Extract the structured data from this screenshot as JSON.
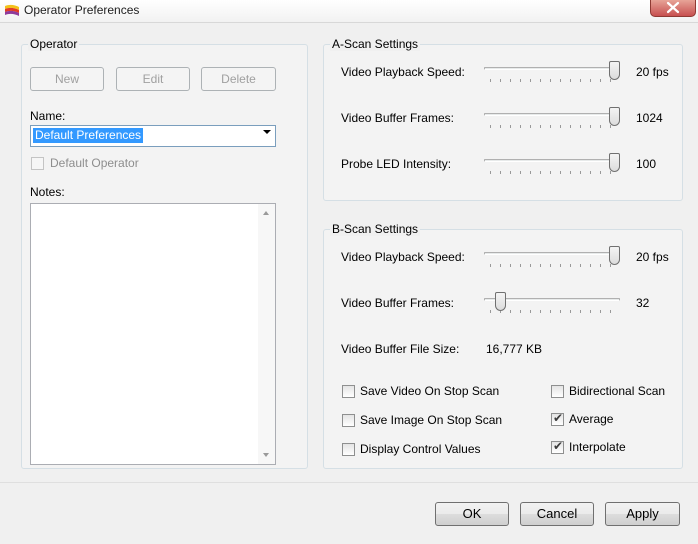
{
  "window": {
    "title": "Operator Preferences",
    "close_label": ""
  },
  "operator": {
    "group_title": "Operator",
    "new_label": "New",
    "edit_label": "Edit",
    "delete_label": "Delete",
    "name_label": "Name:",
    "name_value": "Default Preferences",
    "default_operator_label": "Default Operator",
    "default_operator_checked": false,
    "notes_label": "Notes:",
    "notes_value": ""
  },
  "ascan": {
    "group_title": "A-Scan Settings",
    "playback_speed_label": "Video Playback Speed:",
    "playback_speed_value": "20 fps",
    "playback_speed_fraction": 1.0,
    "buffer_frames_label": "Video Buffer Frames:",
    "buffer_frames_value": "1024",
    "buffer_frames_fraction": 1.0,
    "probe_led_label": "Probe LED Intensity:",
    "probe_led_value": "100",
    "probe_led_fraction": 1.0
  },
  "bscan": {
    "group_title": "B-Scan Settings",
    "playback_speed_label": "Video Playback Speed:",
    "playback_speed_value": "20 fps",
    "playback_speed_fraction": 1.0,
    "buffer_frames_label": "Video Buffer Frames:",
    "buffer_frames_value": "32",
    "buffer_frames_fraction": 0.08,
    "buffer_file_size_label": "Video Buffer File Size:",
    "buffer_file_size_value": "16,777 KB",
    "save_video_label": "Save Video On Stop Scan",
    "save_video_checked": false,
    "save_image_label": "Save Image On Stop Scan",
    "save_image_checked": false,
    "display_control_label": "Display Control Values",
    "display_control_checked": false,
    "bidirectional_label": "Bidirectional Scan",
    "bidirectional_checked": false,
    "average_label": "Average",
    "average_checked": true,
    "interpolate_label": "Interpolate",
    "interpolate_checked": true
  },
  "footer": {
    "ok_label": "OK",
    "cancel_label": "Cancel",
    "apply_label": "Apply"
  },
  "colors": {
    "selection": "#3399ff",
    "close_button": "#c75050"
  }
}
